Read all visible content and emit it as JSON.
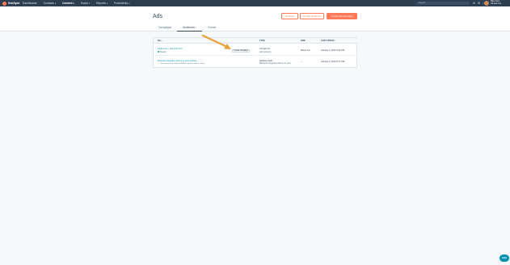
{
  "brand": {
    "name": "HubSpot",
    "accent": "#ff7a59"
  },
  "nav": {
    "items": [
      {
        "label": "Dashboards"
      },
      {
        "label": "Contacts"
      },
      {
        "label": "Content"
      },
      {
        "label": "Social"
      },
      {
        "label": "Reports"
      },
      {
        "label": "Productivity"
      }
    ]
  },
  "search": {
    "placeholder": "Search"
  },
  "account": {
    "line1": "Marc Curie",
    "line2": "hubspot.com"
  },
  "page": {
    "title": "Ads"
  },
  "buttons": {
    "settings": "Settings",
    "create_audience": "Create audience",
    "create_campaign": "Create ad campaign"
  },
  "tabs": [
    {
      "label": "Campaigns",
      "count": ""
    },
    {
      "label": "Audiences",
      "count": "1"
    },
    {
      "label": "Events",
      "count": ""
    }
  ],
  "table": {
    "headers": [
      "NA...",
      "TYPE",
      "SIZE",
      "LAST UPDAT..."
    ],
    "rows": [
      {
        "name": "Audiences – test a fire test",
        "status": "Ready",
        "action": "Create campaign",
        "type": "Contact list",
        "type_sub": "Ads network",
        "size": "Below min",
        "updated": "January 3, 2019 9:44 PM"
      },
      {
        "name": "Business targeting visitors to your website",
        "status": "You may need to add the HubSpot pixel to collect visitors",
        "type": "Website traffic",
        "type_sub": "Business targeting visitors to your",
        "size": "—",
        "updated": "January 3, 2019 8:17 PM"
      }
    ]
  },
  "help": {
    "label": "Help"
  }
}
